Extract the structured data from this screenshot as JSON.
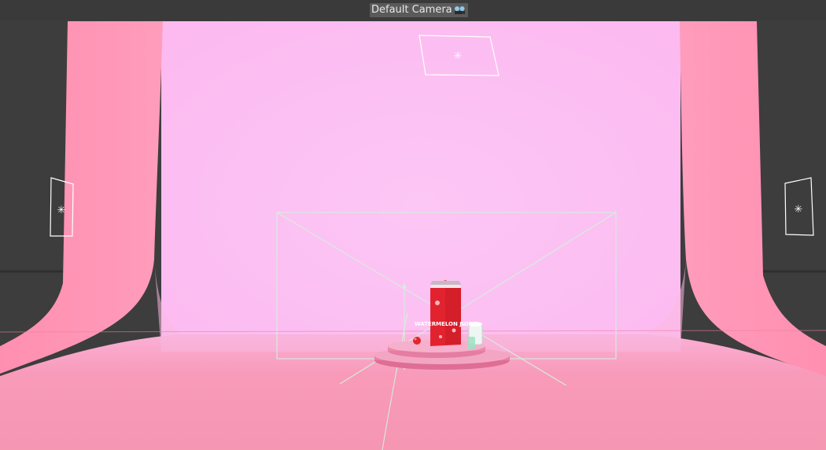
{
  "viewport": {
    "camera_name": "Default Camera",
    "camera_icon": "camera-icon"
  },
  "colors": {
    "background": "#3b3b3b",
    "backdrop": "#fcc2f3",
    "side_walls": "#ff8fb0",
    "floor": "#f798b6",
    "helper_lines": "#d9f0e2",
    "product": "#e5222e"
  },
  "scene": {
    "product_label": "WATERMELON JUICE",
    "light_icon": "light-icon",
    "product_icon": "juice-carton-icon"
  }
}
